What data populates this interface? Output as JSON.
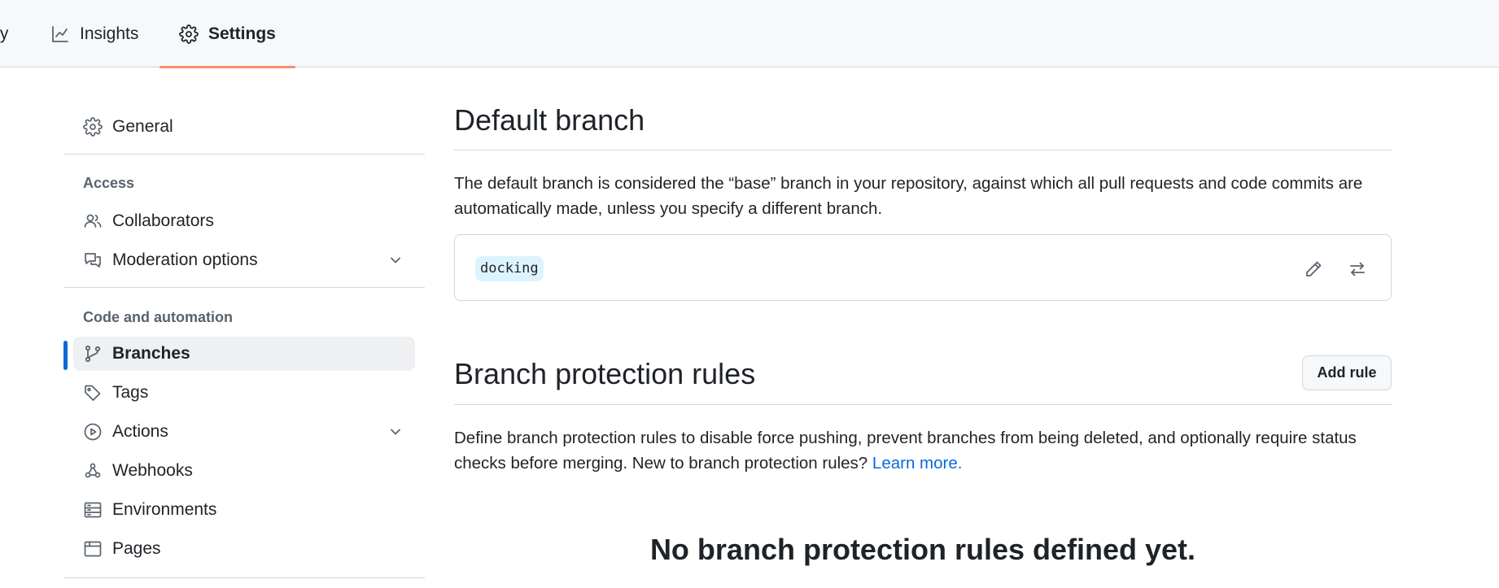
{
  "top_nav": {
    "partial_tab_label": "ty",
    "insights_label": "Insights",
    "settings_label": "Settings"
  },
  "sidebar": {
    "general": "General",
    "access_heading": "Access",
    "collaborators": "Collaborators",
    "moderation": "Moderation options",
    "code_heading": "Code and automation",
    "branches": "Branches",
    "tags": "Tags",
    "actions": "Actions",
    "webhooks": "Webhooks",
    "environments": "Environments",
    "pages": "Pages"
  },
  "default_branch": {
    "title": "Default branch",
    "description": "The default branch is considered the “base” branch in your repository, against which all pull requests and code commits are automatically made, unless you specify a different branch.",
    "branch_name": "docking"
  },
  "protection": {
    "title": "Branch protection rules",
    "add_rule_label": "Add rule",
    "description": "Define branch protection rules to disable force pushing, prevent branches from being deleted, and optionally require status checks before merging. New to branch protection rules?",
    "learn_more": "Learn more.",
    "empty_title": "No branch protection rules defined yet."
  },
  "colors": {
    "accent_blue": "#0969da",
    "tab_underline": "#fd8c73",
    "branch_badge_bg": "#ddf4ff"
  }
}
